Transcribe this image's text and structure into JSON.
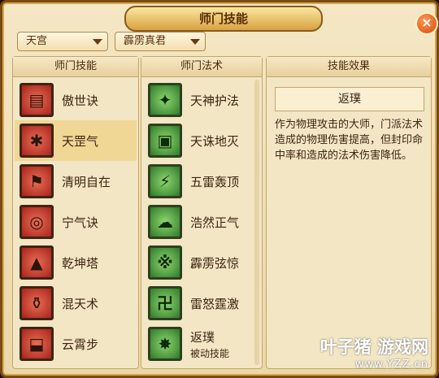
{
  "window": {
    "title": "师门技能",
    "close_glyph": "×"
  },
  "filters": {
    "sect": "天宫",
    "master": "霹雳真君"
  },
  "panels": {
    "skills_header": "师门技能",
    "spells_header": "师门法术",
    "effect_header": "技能效果"
  },
  "skills": [
    {
      "label": "傲世诀",
      "icon": "tablet-icon",
      "glyph": "▤"
    },
    {
      "label": "天罡气",
      "icon": "warrior-icon",
      "glyph": "✱",
      "selected": true
    },
    {
      "label": "清明自在",
      "icon": "flag-icon",
      "glyph": "⚑"
    },
    {
      "label": "宁气诀",
      "icon": "orb-icon",
      "glyph": "◎"
    },
    {
      "label": "乾坤塔",
      "icon": "pagoda-icon",
      "glyph": "▲"
    },
    {
      "label": "混天术",
      "icon": "cauldron-icon",
      "glyph": "⚱"
    },
    {
      "label": "云霄步",
      "icon": "boot-icon",
      "glyph": "⬓"
    }
  ],
  "spells": [
    {
      "label": "天神护法",
      "icon": "guardian-icon",
      "glyph": "✦"
    },
    {
      "label": "天诛地灭",
      "icon": "frame-icon",
      "glyph": "▣"
    },
    {
      "label": "五雷轰顶",
      "icon": "lightning-icon",
      "glyph": "⚡"
    },
    {
      "label": "浩然正气",
      "icon": "cloud-icon",
      "glyph": "☁"
    },
    {
      "label": "霹雳弦惊",
      "icon": "bolt-icon",
      "glyph": "※"
    },
    {
      "label": "雷怒霆激",
      "icon": "thunder-icon",
      "glyph": "卍"
    },
    {
      "label": "返璞",
      "sublabel": "被动技能",
      "icon": "burst-icon",
      "glyph": "✸"
    }
  ],
  "effect": {
    "name": "返璞",
    "description": "作为物理攻击的大师，门派法术造成的物理伤害提高，但封印命中率和造成的法术伤害降低。"
  },
  "watermark": {
    "line1": "叶子猪 游戏网",
    "line2": "www.YZZ.cn"
  }
}
